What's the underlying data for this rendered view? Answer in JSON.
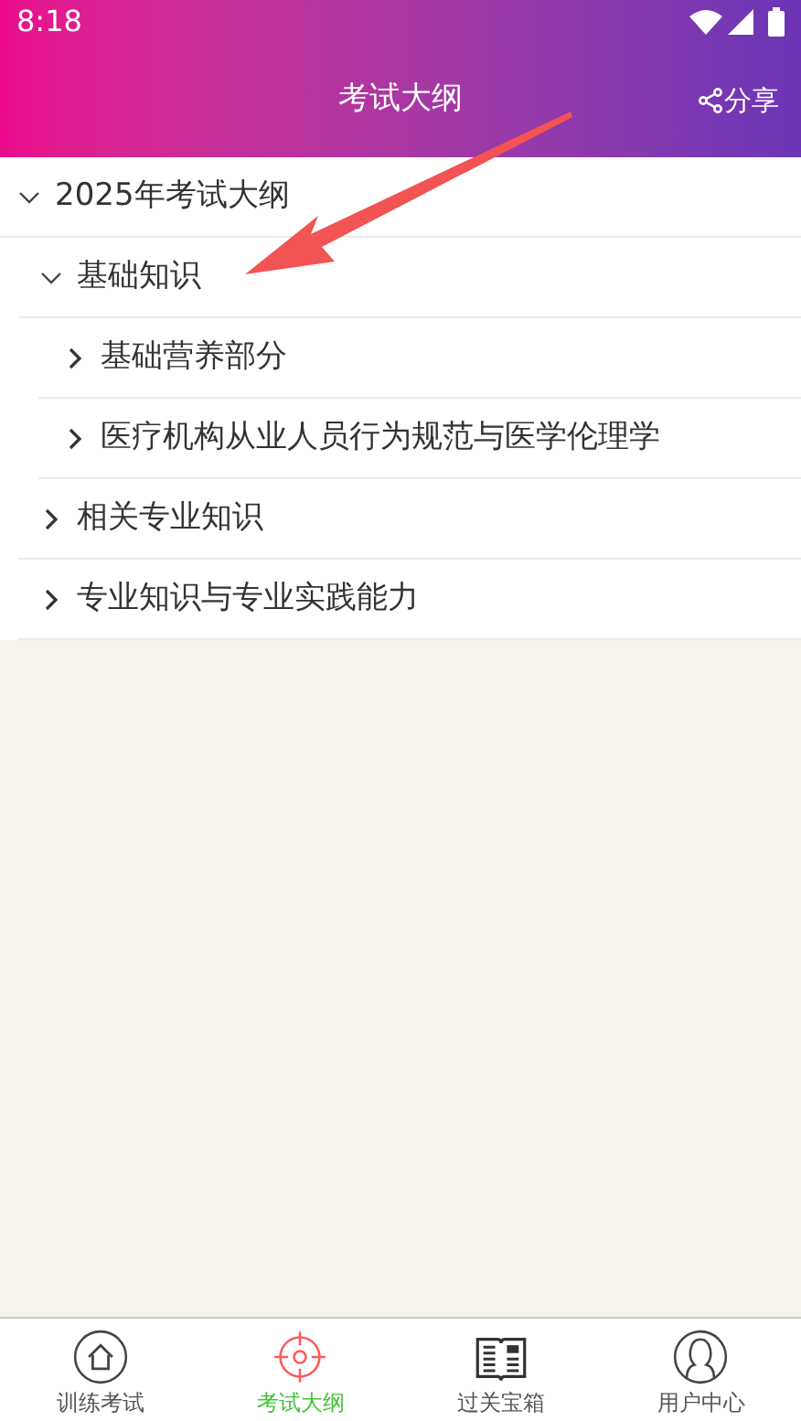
{
  "status_bar": {
    "time": "8:18"
  },
  "header": {
    "title": "考试大纲",
    "share": "分享"
  },
  "outline": [
    {
      "label": "2025年考试大纲",
      "expanded": true,
      "children": [
        {
          "label": "基础知识",
          "expanded": true,
          "children": [
            {
              "label": "基础营养部分",
              "expanded": false
            },
            {
              "label": "医疗机构从业人员行为规范与医学伦理学",
              "expanded": false
            }
          ]
        },
        {
          "label": "相关专业知识",
          "expanded": false
        },
        {
          "label": "专业知识与专业实践能力",
          "expanded": false
        }
      ]
    }
  ],
  "tabs": [
    {
      "label": "训练考试",
      "selected": false
    },
    {
      "label": "考试大纲",
      "selected": true
    },
    {
      "label": "过关宝箱",
      "selected": false
    },
    {
      "label": "用户中心",
      "selected": false
    }
  ]
}
